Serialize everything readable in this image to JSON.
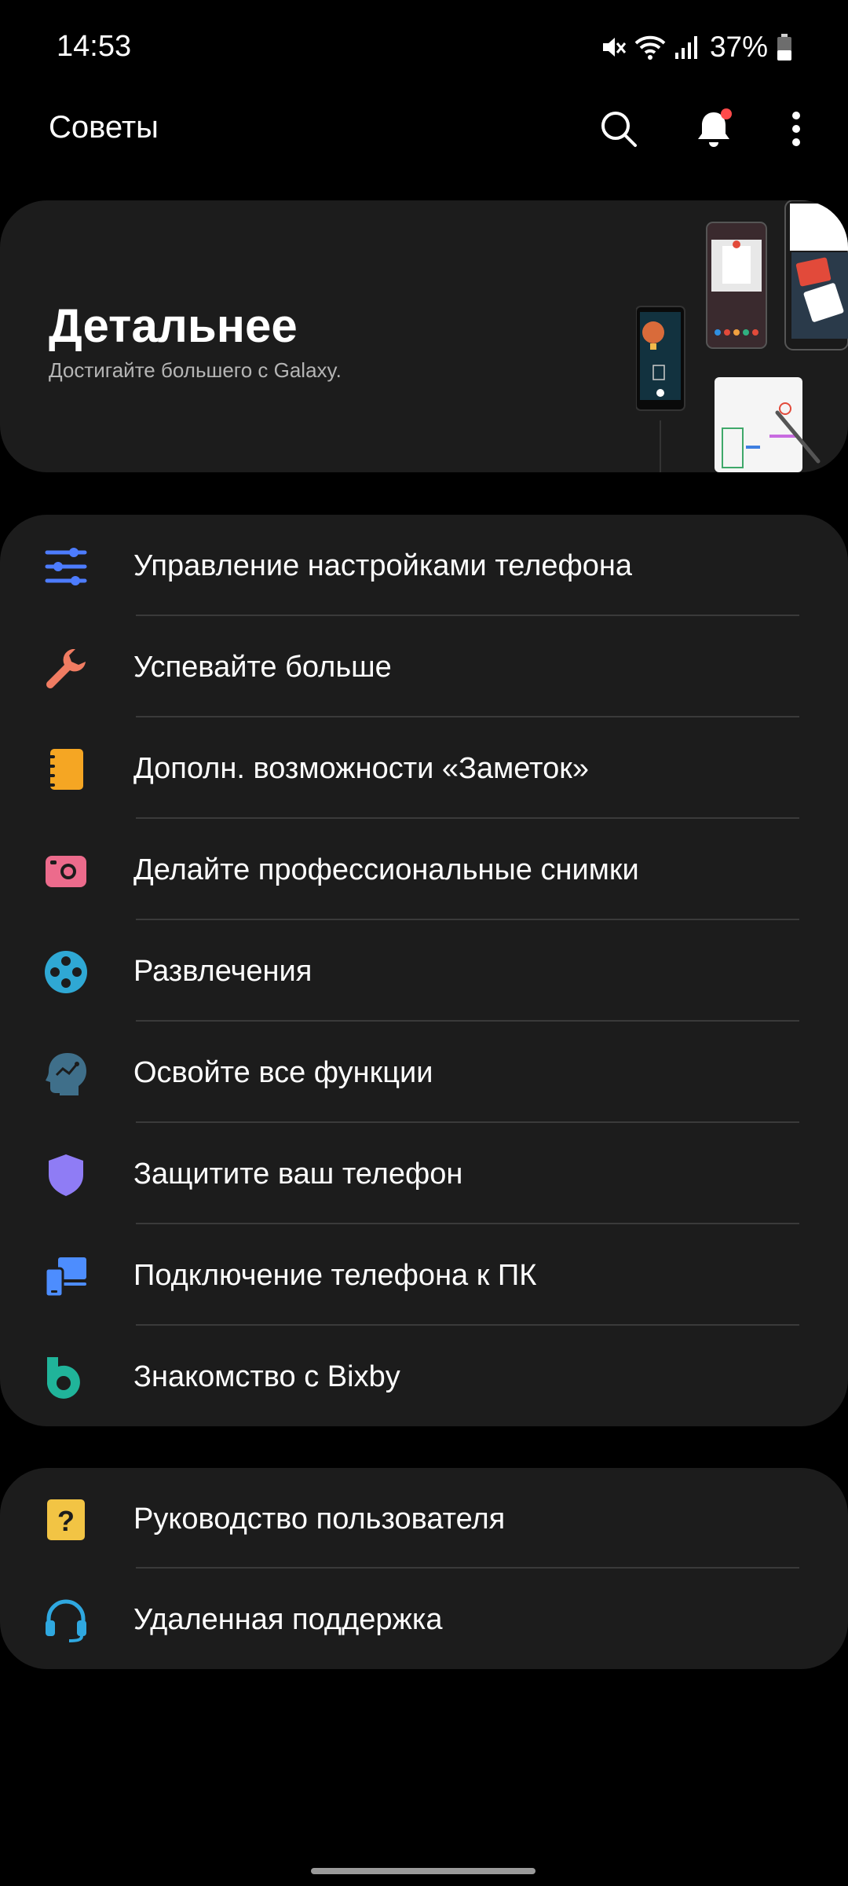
{
  "status_bar": {
    "time": "14:53",
    "battery_percent": "37%",
    "icons": [
      "mute-vibrate-icon",
      "wifi-icon",
      "signal-icon",
      "battery-icon"
    ]
  },
  "app_bar": {
    "title": "Советы",
    "actions": [
      "search-icon",
      "bell-icon",
      "more-vert-icon"
    ],
    "notification_dot_color": "#ff4a4a"
  },
  "hero": {
    "title": "Детальнее",
    "subtitle": "Достигайте большего с Galaxy."
  },
  "menu": {
    "items": [
      {
        "label": "Управление настройками телефона",
        "icon": "sliders-icon",
        "color": "#4d7cfe"
      },
      {
        "label": "Успевайте больше",
        "icon": "wrench-icon",
        "color": "#f07c62"
      },
      {
        "label": "Дополн. возможности «Заметок»",
        "icon": "notebook-icon",
        "color": "#f5a623"
      },
      {
        "label": "Делайте профессиональные снимки",
        "icon": "camera-icon",
        "color": "#ec6b8c"
      },
      {
        "label": "Развлечения",
        "icon": "gamepad-icon",
        "color": "#2fa8d4"
      },
      {
        "label": "Освойте все функции",
        "icon": "head-icon",
        "color": "#3f6f8a"
      },
      {
        "label": "Защитите ваш телефон",
        "icon": "shield-icon",
        "color": "#8f7cf5"
      },
      {
        "label": "Подключение телефона к ПК",
        "icon": "devices-icon",
        "color": "#4d8dfe"
      },
      {
        "label": "Знакомство с Bixby",
        "icon": "bixby-icon",
        "color": "#20b49a"
      }
    ]
  },
  "support": {
    "items": [
      {
        "label": "Руководство пользователя",
        "icon": "help-book-icon",
        "color": "#f2c444"
      },
      {
        "label": "Удаленная поддержка",
        "icon": "headset-icon",
        "color": "#2fa8e0"
      }
    ]
  }
}
